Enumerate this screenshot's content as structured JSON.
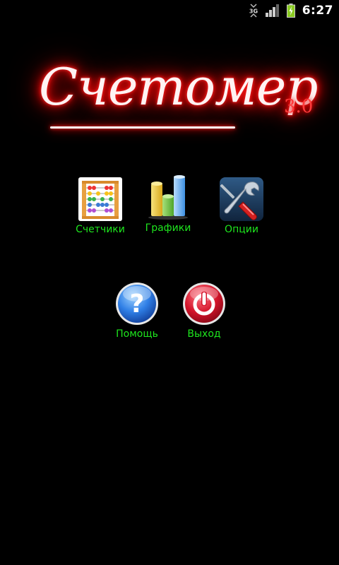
{
  "status_bar": {
    "network_label": "3G",
    "signal_icon": "signal-bars-icon",
    "battery_icon": "battery-charging-icon",
    "time": "6:27"
  },
  "logo": {
    "title": "Счетомер",
    "version": "3.0"
  },
  "menu": {
    "counters": {
      "label": "Счетчики",
      "icon": "abacus-icon"
    },
    "charts": {
      "label": "Графики",
      "icon": "bar-chart-icon"
    },
    "options": {
      "label": "Опции",
      "icon": "tools-icon"
    },
    "help": {
      "label": "Помощь",
      "icon": "help-icon"
    },
    "exit": {
      "label": "Выход",
      "icon": "power-icon"
    }
  },
  "colors": {
    "background": "#000000",
    "label": "#1ee61e",
    "logo_glow": "#ff0000"
  }
}
